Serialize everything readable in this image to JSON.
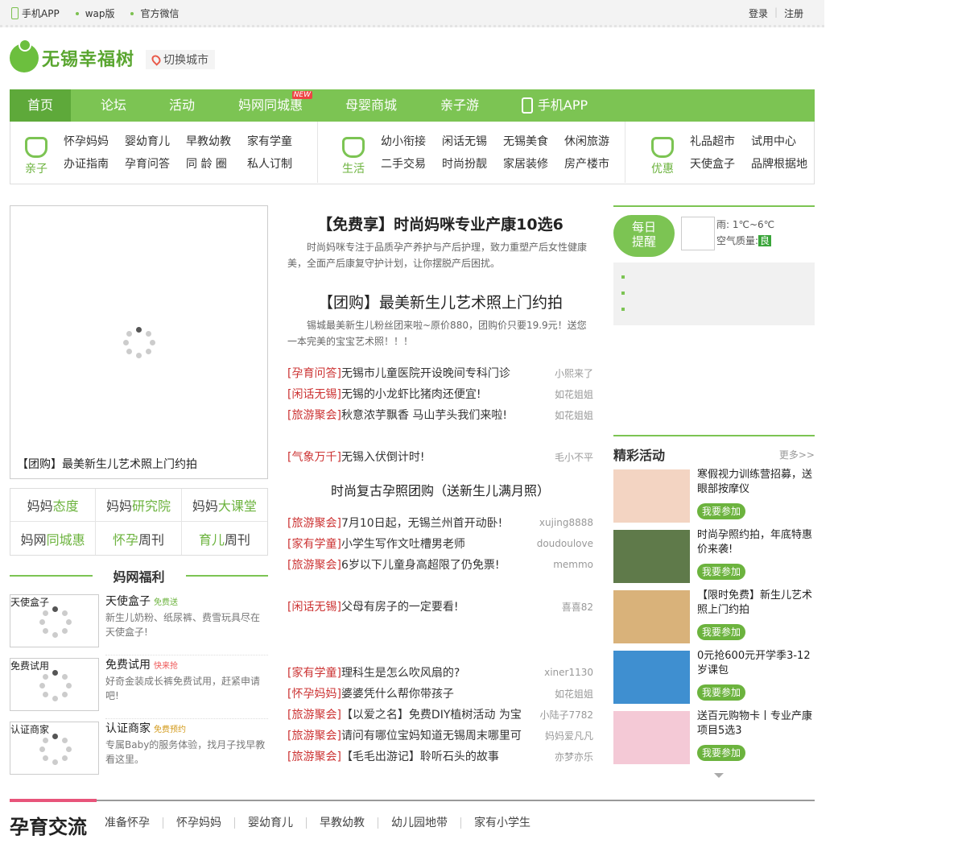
{
  "topbar": {
    "app": "手机APP",
    "wap": "wap版",
    "wechat": "官方微信",
    "login": "登录",
    "register": "注册"
  },
  "logo": {
    "text": "无锡幸福树"
  },
  "city": {
    "label": "切换城市"
  },
  "nav": {
    "items": [
      "首页",
      "论坛",
      "活动",
      "妈网同城惠",
      "母婴商城",
      "亲子游",
      "手机APP"
    ],
    "new_badge": "NEW"
  },
  "subnav": {
    "groups": [
      {
        "cat": "亲子",
        "links": [
          "怀孕妈妈",
          "婴幼育儿",
          "早教幼教",
          "家有学童",
          "办证指南",
          "孕育问答",
          "同 龄 圈",
          "私人订制"
        ]
      },
      {
        "cat": "生活",
        "links": [
          "幼小衔接",
          "闲话无锡",
          "无锡美食",
          "休闲旅游",
          "二手交易",
          "时尚扮靓",
          "家居装修",
          "房产楼市"
        ]
      },
      {
        "cat": "优惠",
        "links": [
          "礼品超市",
          "试用中心",
          "天使盒子",
          "品牌根据地"
        ]
      }
    ]
  },
  "slider": {
    "caption": "【团购】最美新生儿艺术照上门约拍"
  },
  "mama": {
    "items": [
      {
        "a": "妈妈",
        "b": "态度"
      },
      {
        "a": "妈妈",
        "b": "研究院"
      },
      {
        "a": "妈妈",
        "b": "大课堂"
      },
      {
        "a": "妈网",
        "b": "同城惠"
      },
      {
        "a": "怀孕",
        "b": "周刊"
      },
      {
        "a": "育儿",
        "b": "周刊"
      }
    ]
  },
  "fuli": {
    "title": "妈网福利",
    "items": [
      {
        "label": "天使盒子",
        "title": "天使盒子",
        "tag": "免费送",
        "desc": "新生儿奶粉、纸尿裤、费雪玩具尽在天使盒子!"
      },
      {
        "label": "免费试用",
        "title": "免费试用",
        "tag": "快来抢",
        "desc": "好奇金装成长裤免费试用，赶紧申请吧!"
      },
      {
        "label": "认证商家",
        "title": "认证商家",
        "tag": "免费预约",
        "desc": "专属Baby的服务体验，找月子找早教看这里。"
      }
    ]
  },
  "center": {
    "h1": "【免费享】时尚妈咪专业产康10选6",
    "s1": "时尚妈咪专注于品质孕产养护与产后护理，致力重塑产后女性健康美，全面产后康复守护计划，让你摆脱产后困扰。",
    "h2": "【团购】最美新生儿艺术照上门约拍",
    "s2": "锡城最美新生儿粉丝团来啦~原价880，团购价只要19.9元！送您一本完美的宝宝艺术照！！！",
    "list1": [
      {
        "cat": "[孕育问答]",
        "text": "无锡市儿童医院开设晚间专科门诊",
        "author": "小熙来了"
      },
      {
        "cat": "[闲话无锡]",
        "text": "无锡的小龙虾比猪肉还便宜!",
        "author": "如花姐姐"
      },
      {
        "cat": "[旅游聚会]",
        "text": "秋意浓芋飘香 马山芋头我们来啦!",
        "author": "如花姐姐"
      }
    ],
    "list2": [
      {
        "cat": "[气象万千]",
        "text": "无锡入伏倒计时!",
        "author": "毛小不平"
      }
    ],
    "h3": "时尚复古孕照团购（送新生儿满月照）",
    "list3": [
      {
        "cat": "[旅游聚会]",
        "text": "7月10日起，无锡兰州首开动卧!",
        "author": "xujing8888"
      },
      {
        "cat": "[家有学童]",
        "text": "小学生写作文吐槽男老师",
        "author": "doudoulove"
      },
      {
        "cat": "[旅游聚会]",
        "text": "6岁以下儿童身高超限了仍免票!",
        "author": "memmo"
      }
    ],
    "list4": [
      {
        "cat": "[闲话无锡]",
        "text": "父母有房子的一定要看!",
        "author": "喜喜82"
      }
    ],
    "list5": [
      {
        "cat": "[家有学童]",
        "text": "理科生是怎么吹风扇的?",
        "author": "xiner1130"
      },
      {
        "cat": "[怀孕妈妈]",
        "text": "婆婆凭什么帮你带孩子",
        "author": "如花姐姐"
      },
      {
        "cat": "[旅游聚会]",
        "text": "【以爱之名】免费DIY植树活动 为宝",
        "author": "小陆子7782"
      },
      {
        "cat": "[旅游聚会]",
        "text": "请问有哪位宝妈知道无锡周末哪里可",
        "author": "妈妈爱凡凡"
      },
      {
        "cat": "[旅游聚会]",
        "text": "【毛毛出游记】聆听石头的故事",
        "author": "亦梦亦乐"
      }
    ]
  },
  "remind": {
    "badge1": "每日",
    "badge2": "提醒",
    "weather": "雨: 1℃~6℃",
    "aq_label": "空气质量:",
    "aq": "良"
  },
  "activities": {
    "title": "精彩活动",
    "more": "更多>>",
    "join": "我要参加",
    "items": [
      {
        "text": "寒假视力训练营招募，送眼部按摩仪",
        "color": "#f3d4c2"
      },
      {
        "text": "时尚孕照约拍，年底特惠价来袭!",
        "color": "#5f7a4a"
      },
      {
        "text": "【限时免费】新生儿艺术照上门约拍",
        "color": "#d9b27a"
      },
      {
        "text": "0元抢600元开学季3-12岁课包",
        "color": "#3f8fd0"
      },
      {
        "text": "送百元购物卡丨专业产康项目5选3",
        "color": "#f4c9d6"
      }
    ]
  },
  "section": {
    "title": "孕育交流",
    "tabs": [
      "准备怀孕",
      "怀孕妈妈",
      "婴幼育儿",
      "早教幼教",
      "幼儿园地带",
      "家有小学生"
    ]
  }
}
